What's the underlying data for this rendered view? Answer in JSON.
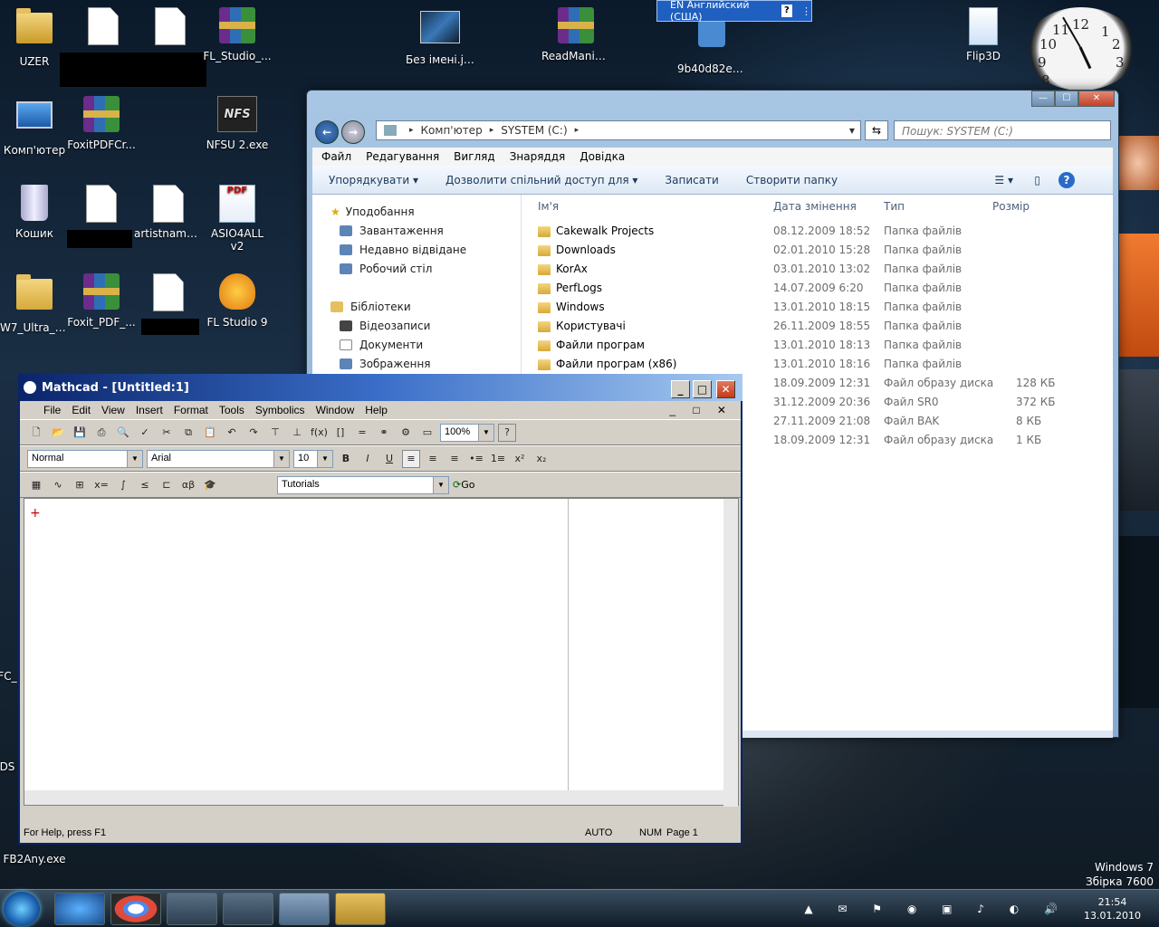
{
  "desktop": {
    "icons": [
      {
        "label": "UZER",
        "type": "user-folder"
      },
      {
        "label": "FL_Studio_...",
        "type": "rar"
      },
      {
        "label": "Без імені.jpg",
        "type": "image"
      },
      {
        "label": "ReadMania...",
        "type": "rar"
      },
      {
        "label": "9b40d82e1...",
        "type": "media"
      },
      {
        "label": "Flip3D",
        "type": "shortcut"
      },
      {
        "label": "Комп'ютер",
        "type": "computer"
      },
      {
        "label": "FoxitPDFCr...",
        "type": "rar"
      },
      {
        "label": "NFSU 2.exe",
        "type": "game"
      },
      {
        "label": "Кошик",
        "type": "recycle-bin"
      },
      {
        "label": "artistname...",
        "type": "mp3"
      },
      {
        "label": "ASIO4ALL v2 Instruction...",
        "type": "pdf"
      },
      {
        "label": "W7_Ultra_H...",
        "type": "folder"
      },
      {
        "label": "Foxit_PDF_...",
        "type": "rar"
      },
      {
        "label": "FL Studio 9",
        "type": "app"
      },
      {
        "label": "FB2Any.exe",
        "type": "app"
      },
      {
        "label": "FC_",
        "type": "app"
      },
      {
        "label": "DS",
        "type": "app"
      }
    ],
    "language_bar": {
      "text": "EN Английский (США)",
      "help": "?"
    },
    "clock_numbers": [
      "12",
      "1",
      "2",
      "3",
      "8",
      "9",
      "10",
      "11"
    ],
    "watermark": {
      "line1": "Windows 7",
      "line2": "Збірка 7600"
    },
    "accent": "#1f5fbf"
  },
  "explorer": {
    "controls": [
      "—",
      "☐",
      "✕"
    ],
    "address": {
      "parts": [
        "Комп'ютер",
        "SYSTEM (C:)"
      ]
    },
    "search_placeholder": "Пошук: SYSTEM (C:)",
    "menu": [
      "Файл",
      "Редагування",
      "Вигляд",
      "Знаряддя",
      "Довідка"
    ],
    "toolbar": [
      "Упорядкувати ▾",
      "Дозволити спільний доступ для ▾",
      "Записати",
      "Створити папку"
    ],
    "nav": {
      "favorites": "Уподобання",
      "favorites_items": [
        "Завантаження",
        "Недавно відвідане",
        "Робочий стіл"
      ],
      "libraries": "Бібліотеки",
      "libraries_items": [
        "Відеозаписи",
        "Документи",
        "Зображення"
      ]
    },
    "columns": [
      "Ім'я",
      "Дата змінення",
      "Тип",
      "Розмір"
    ],
    "rows": [
      {
        "name": "Cakewalk Projects",
        "date": "08.12.2009 18:52",
        "type": "Папка файлів",
        "size": ""
      },
      {
        "name": "Downloads",
        "date": "02.01.2010 15:28",
        "type": "Папка файлів",
        "size": ""
      },
      {
        "name": "KorAx",
        "date": "03.01.2010 13:02",
        "type": "Папка файлів",
        "size": ""
      },
      {
        "name": "PerfLogs",
        "date": "14.07.2009 6:20",
        "type": "Папка файлів",
        "size": ""
      },
      {
        "name": "Windows",
        "date": "13.01.2010 18:15",
        "type": "Папка файлів",
        "size": ""
      },
      {
        "name": "Користувачі",
        "date": "26.11.2009 18:55",
        "type": "Папка файлів",
        "size": ""
      },
      {
        "name": "Файли програм",
        "date": "13.01.2010 18:13",
        "type": "Папка файлів",
        "size": ""
      },
      {
        "name": "Файли програм (x86)",
        "date": "13.01.2010 18:16",
        "type": "Папка файлів",
        "size": ""
      },
      {
        "name": "",
        "date": "18.09.2009 12:31",
        "type": "Файл образу диска",
        "size": "128 КБ"
      },
      {
        "name": "",
        "date": "31.12.2009 20:36",
        "type": "Файл SR0",
        "size": "372 КБ"
      },
      {
        "name": "",
        "date": "27.11.2009 21:08",
        "type": "Файл BAK",
        "size": "8 КБ"
      },
      {
        "name": "",
        "date": "18.09.2009 12:31",
        "type": "Файл образу диска",
        "size": "1 КБ"
      }
    ]
  },
  "mathcad": {
    "title": "Mathcad - [Untitled:1]",
    "menu": [
      "File",
      "Edit",
      "View",
      "Insert",
      "Format",
      "Tools",
      "Symbolics",
      "Window",
      "Help"
    ],
    "zoom": "100%",
    "style": "Normal",
    "font": "Arial",
    "size": "10",
    "tutorials": "Tutorials",
    "go": "Go",
    "status": {
      "help": "For Help, press F1",
      "mode": "AUTO",
      "num": "NUM",
      "page": "Page 1"
    },
    "fmt_buttons": [
      "B",
      "I",
      "U"
    ]
  },
  "taskbar": {
    "time": "21:54",
    "date": "13.01.2010"
  }
}
